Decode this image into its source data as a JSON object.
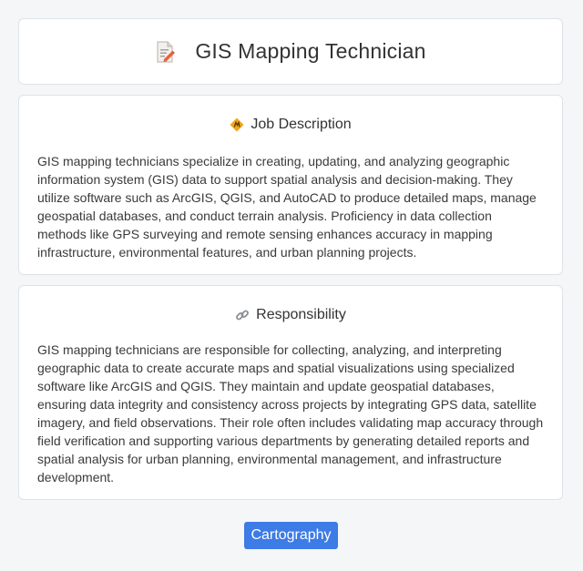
{
  "header": {
    "title": "GIS Mapping Technician",
    "icon": "document-edit-icon"
  },
  "job_description": {
    "heading": "Job Description",
    "icon": "map-pin-icon",
    "text": "GIS mapping technicians specialize in creating, updating, and analyzing geographic information system (GIS) data to support spatial analysis and decision-making. They utilize software such as ArcGIS, QGIS, and AutoCAD to produce detailed maps, manage geospatial databases, and conduct terrain analysis. Proficiency in data collection methods like GPS surveying and remote sensing enhances accuracy in mapping infrastructure, environmental features, and urban planning projects."
  },
  "responsibility": {
    "heading": "Responsibility",
    "icon": "link-icon",
    "text": "GIS mapping technicians are responsible for collecting, analyzing, and interpreting geographic data to create accurate maps and spatial visualizations using specialized software like ArcGIS and QGIS. They maintain and update geospatial databases, ensuring data integrity and consistency across projects by integrating GPS data, satellite imagery, and field observations. Their role often includes validating map accuracy through field verification and supporting various departments by generating detailed reports and spatial analysis for urban planning, environmental management, and infrastructure development."
  },
  "tags": [
    {
      "label": "Cartography"
    }
  ],
  "colors": {
    "tag_background": "#3d7be6",
    "page_background": "#f5f6f8"
  }
}
